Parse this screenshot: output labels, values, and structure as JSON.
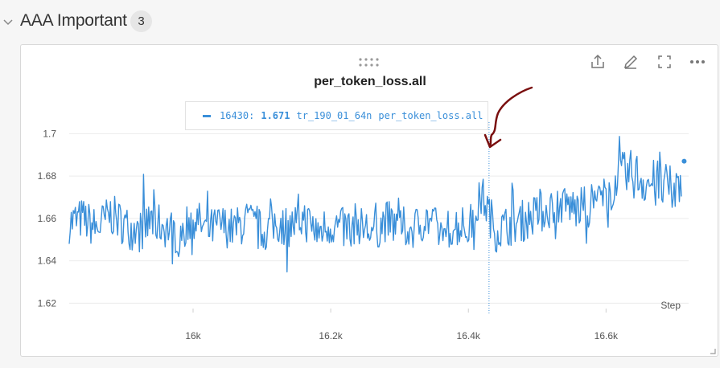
{
  "section": {
    "title": "AAA Important",
    "count": "3"
  },
  "panel": {
    "title": "per_token_loss.all",
    "toolbar": {
      "share_icon": "share-icon",
      "edit_icon": "pencil-icon",
      "fullscreen_icon": "fullscreen-icon",
      "more_icon": "more-icon"
    },
    "tooltip": {
      "step": "16430:",
      "value": "1.671",
      "run": "tr_190_01_64n",
      "metric": "per_token_loss.all"
    }
  },
  "colors": {
    "series": "#3a8fd9",
    "annotation": "#7a0f0f",
    "grid": "#ececec"
  },
  "chart_data": {
    "type": "line",
    "title": "per_token_loss.all",
    "xlabel": "Step",
    "ylabel": "",
    "xlim": [
      15820,
      16720
    ],
    "ylim": [
      1.6175,
      1.7115
    ],
    "x_ticks": [
      16000,
      16200,
      16400,
      16600
    ],
    "x_tick_labels": [
      "16k",
      "16.2k",
      "16.4k",
      "16.6k"
    ],
    "y_ticks": [
      1.62,
      1.64,
      1.66,
      1.68,
      1.7
    ],
    "y_tick_labels": [
      "1.62",
      "1.64",
      "1.66",
      "1.68",
      "1.7"
    ],
    "grid": true,
    "hover_step": 16430,
    "series": [
      {
        "name": "tr_190_01_64n per_token_loss.all",
        "x": [
          15820,
          15840,
          15860,
          15880,
          15900,
          15920,
          15940,
          15960,
          15980,
          16000,
          16020,
          16040,
          16060,
          16080,
          16100,
          16120,
          16140,
          16160,
          16180,
          16200,
          16220,
          16240,
          16260,
          16280,
          16300,
          16320,
          16340,
          16360,
          16380,
          16400,
          16420,
          16440,
          16460,
          16480,
          16500,
          16520,
          16540,
          16560,
          16580,
          16600,
          16620,
          16640,
          16660,
          16680,
          16700,
          16720
        ],
        "y": [
          1.658,
          1.66,
          1.655,
          1.662,
          1.657,
          1.653,
          1.659,
          1.656,
          1.652,
          1.661,
          1.654,
          1.657,
          1.655,
          1.659,
          1.653,
          1.658,
          1.656,
          1.66,
          1.654,
          1.657,
          1.655,
          1.658,
          1.653,
          1.659,
          1.656,
          1.655,
          1.66,
          1.653,
          1.657,
          1.655,
          1.671,
          1.654,
          1.657,
          1.659,
          1.662,
          1.665,
          1.667,
          1.664,
          1.668,
          1.67,
          1.679,
          1.681,
          1.677,
          1.675,
          1.672,
          1.687
        ]
      }
    ]
  }
}
